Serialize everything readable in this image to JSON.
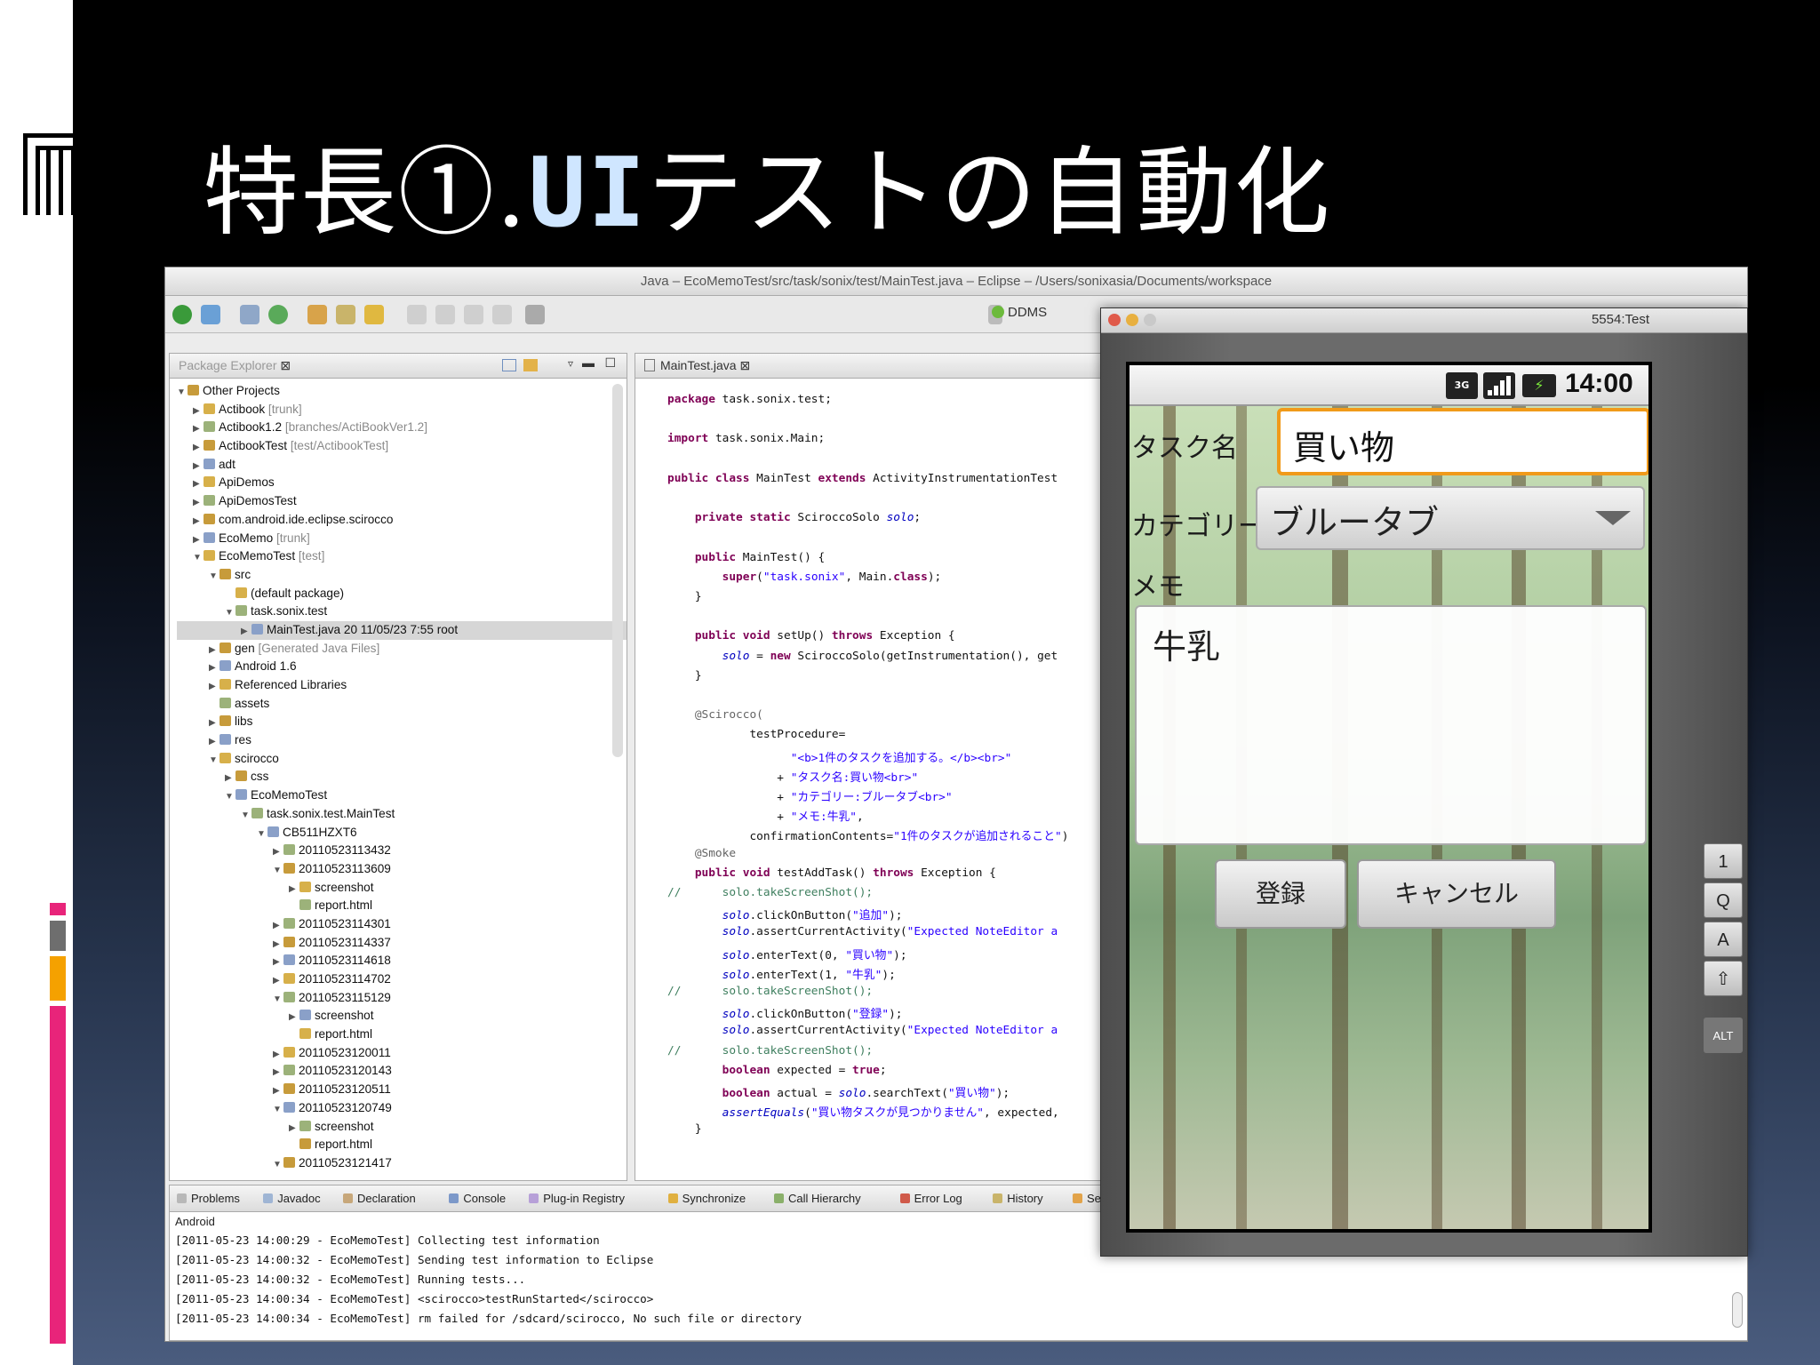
{
  "slide": {
    "title_prefix": "特長①.",
    "title_ui": "UI",
    "title_suffix": "テストの自動化"
  },
  "colors": {
    "accent_pink": "#e8247a",
    "accent_gray": "#6e6e6e",
    "accent_orange": "#f5a100",
    "input_focus_orange": "#f09a1a"
  },
  "eclipse": {
    "window_title": "Java – EcoMemoTest/src/task/sonix/test/MainTest.java – Eclipse – /Users/sonixasia/Documents/workspace",
    "perspective_label": "DDMS",
    "package_explorer_tab": "Package Explorer",
    "editor_tab": "MainTest.java",
    "tree": [
      {
        "label": "Other Projects",
        "suffix": "",
        "depth": 0,
        "twisty": "open"
      },
      {
        "label": "Actibook",
        "suffix": "[trunk]",
        "depth": 1,
        "twisty": "closed"
      },
      {
        "label": "Actibook1.2",
        "suffix": "[branches/ActiBookVer1.2]",
        "depth": 1,
        "twisty": "closed"
      },
      {
        "label": "ActibookTest",
        "suffix": "[test/ActibookTest]",
        "depth": 1,
        "twisty": "closed"
      },
      {
        "label": "adt",
        "suffix": "",
        "depth": 1,
        "twisty": "closed"
      },
      {
        "label": "ApiDemos",
        "suffix": "",
        "depth": 1,
        "twisty": "closed"
      },
      {
        "label": "ApiDemosTest",
        "suffix": "",
        "depth": 1,
        "twisty": "closed"
      },
      {
        "label": "com.android.ide.eclipse.scirocco",
        "suffix": "",
        "depth": 1,
        "twisty": "closed"
      },
      {
        "label": "EcoMemo",
        "suffix": "[trunk]",
        "depth": 1,
        "twisty": "closed"
      },
      {
        "label": "EcoMemoTest",
        "suffix": "[test]",
        "depth": 1,
        "twisty": "open"
      },
      {
        "label": "src",
        "suffix": "",
        "depth": 2,
        "twisty": "open"
      },
      {
        "label": "(default package)",
        "suffix": "",
        "depth": 3,
        "twisty": ""
      },
      {
        "label": "task.sonix.test",
        "suffix": "",
        "depth": 3,
        "twisty": "open"
      },
      {
        "label": "MainTest.java 20  11/05/23 7:55  root",
        "suffix": "",
        "depth": 4,
        "twisty": "closed",
        "selected": true
      },
      {
        "label": "gen",
        "suffix": "[Generated Java Files]",
        "depth": 2,
        "twisty": "closed"
      },
      {
        "label": "Android 1.6",
        "suffix": "",
        "depth": 2,
        "twisty": "closed"
      },
      {
        "label": "Referenced Libraries",
        "suffix": "",
        "depth": 2,
        "twisty": "closed"
      },
      {
        "label": "assets",
        "suffix": "",
        "depth": 2,
        "twisty": ""
      },
      {
        "label": "libs",
        "suffix": "",
        "depth": 2,
        "twisty": "closed"
      },
      {
        "label": "res",
        "suffix": "",
        "depth": 2,
        "twisty": "closed"
      },
      {
        "label": "scirocco",
        "suffix": "",
        "depth": 2,
        "twisty": "open"
      },
      {
        "label": "css",
        "suffix": "",
        "depth": 3,
        "twisty": "closed"
      },
      {
        "label": "EcoMemoTest",
        "suffix": "",
        "depth": 3,
        "twisty": "open"
      },
      {
        "label": "task.sonix.test.MainTest",
        "suffix": "",
        "depth": 4,
        "twisty": "open"
      },
      {
        "label": "CB511HZXT6",
        "suffix": "",
        "depth": 5,
        "twisty": "open"
      },
      {
        "label": "20110523113432",
        "suffix": "",
        "depth": 6,
        "twisty": "closed"
      },
      {
        "label": "20110523113609",
        "suffix": "",
        "depth": 6,
        "twisty": "open"
      },
      {
        "label": "screenshot",
        "suffix": "",
        "depth": 7,
        "twisty": "closed"
      },
      {
        "label": "report.html",
        "suffix": "",
        "depth": 7,
        "twisty": ""
      },
      {
        "label": "20110523114301",
        "suffix": "",
        "depth": 6,
        "twisty": "closed"
      },
      {
        "label": "20110523114337",
        "suffix": "",
        "depth": 6,
        "twisty": "closed"
      },
      {
        "label": "20110523114618",
        "suffix": "",
        "depth": 6,
        "twisty": "closed"
      },
      {
        "label": "20110523114702",
        "suffix": "",
        "depth": 6,
        "twisty": "closed"
      },
      {
        "label": "20110523115129",
        "suffix": "",
        "depth": 6,
        "twisty": "open"
      },
      {
        "label": "screenshot",
        "suffix": "",
        "depth": 7,
        "twisty": "closed"
      },
      {
        "label": "report.html",
        "suffix": "",
        "depth": 7,
        "twisty": ""
      },
      {
        "label": "20110523120011",
        "suffix": "",
        "depth": 6,
        "twisty": "closed"
      },
      {
        "label": "20110523120143",
        "suffix": "",
        "depth": 6,
        "twisty": "closed"
      },
      {
        "label": "20110523120511",
        "suffix": "",
        "depth": 6,
        "twisty": "closed"
      },
      {
        "label": "20110523120749",
        "suffix": "",
        "depth": 6,
        "twisty": "open"
      },
      {
        "label": "screenshot",
        "suffix": "",
        "depth": 7,
        "twisty": "closed"
      },
      {
        "label": "report.html",
        "suffix": "",
        "depth": 7,
        "twisty": ""
      },
      {
        "label": "20110523121417",
        "suffix": "",
        "depth": 6,
        "twisty": "open"
      }
    ],
    "code_lines": [
      [
        [
          "kw",
          "package"
        ],
        [
          "n",
          " task.sonix.test;"
        ]
      ],
      [],
      [
        [
          "kw",
          "import"
        ],
        [
          "n",
          " task.sonix.Main;"
        ]
      ],
      [],
      [
        [
          "kw",
          "public class"
        ],
        [
          "n",
          " MainTest "
        ],
        [
          "kw",
          "extends"
        ],
        [
          "n",
          " ActivityInstrumentationTest"
        ]
      ],
      [],
      [
        [
          "n",
          "    "
        ],
        [
          "kw",
          "private static"
        ],
        [
          "n",
          " SciroccoSolo "
        ],
        [
          "fld",
          "solo"
        ],
        [
          "n",
          ";"
        ]
      ],
      [],
      [
        [
          "n",
          "    "
        ],
        [
          "kw",
          "public"
        ],
        [
          "n",
          " MainTest() {"
        ]
      ],
      [
        [
          "n",
          "        "
        ],
        [
          "kw",
          "super"
        ],
        [
          "n",
          "("
        ],
        [
          "str",
          "\"task.sonix\""
        ],
        [
          "n",
          ", Main."
        ],
        [
          "kw",
          "class"
        ],
        [
          "n",
          ");"
        ]
      ],
      [
        [
          "n",
          "    }"
        ]
      ],
      [],
      [
        [
          "n",
          "    "
        ],
        [
          "kw",
          "public void"
        ],
        [
          "n",
          " setUp() "
        ],
        [
          "kw",
          "throws"
        ],
        [
          "n",
          " Exception {"
        ]
      ],
      [
        [
          "n",
          "        "
        ],
        [
          "fld",
          "solo"
        ],
        [
          "n",
          " = "
        ],
        [
          "kw",
          "new"
        ],
        [
          "n",
          " SciroccoSolo(getInstrumentation(), get"
        ]
      ],
      [
        [
          "n",
          "    }"
        ]
      ],
      [],
      [
        [
          "ann",
          "    @Scirocco("
        ]
      ],
      [
        [
          "n",
          "            testProcedure="
        ]
      ],
      [
        [
          "n",
          "                  "
        ],
        [
          "str",
          "\"<b>1件のタスクを追加する。</b><br>\""
        ]
      ],
      [
        [
          "n",
          "                + "
        ],
        [
          "str",
          "\"タスク名:買い物<br>\""
        ]
      ],
      [
        [
          "n",
          "                + "
        ],
        [
          "str",
          "\"カテゴリー:ブルータブ<br>\""
        ]
      ],
      [
        [
          "n",
          "                + "
        ],
        [
          "str",
          "\"メモ:牛乳\""
        ],
        [
          "n",
          ","
        ]
      ],
      [
        [
          "n",
          "            confirmationContents="
        ],
        [
          "str",
          "\"1件のタスクが追加されること\""
        ],
        [
          "n",
          ")"
        ]
      ],
      [
        [
          "ann",
          "    @Smoke"
        ]
      ],
      [
        [
          "n",
          "    "
        ],
        [
          "kw",
          "public void"
        ],
        [
          "n",
          " testAddTask() "
        ],
        [
          "kw",
          "throws"
        ],
        [
          "n",
          " Exception {"
        ]
      ],
      [
        [
          "cm",
          "//      solo.takeScreenShot();"
        ]
      ],
      [
        [
          "n",
          "        "
        ],
        [
          "fld",
          "solo"
        ],
        [
          "n",
          ".clickOnButton("
        ],
        [
          "str",
          "\"追加\""
        ],
        [
          "n",
          ");"
        ]
      ],
      [
        [
          "n",
          "        "
        ],
        [
          "fld",
          "solo"
        ],
        [
          "n",
          ".assertCurrentActivity("
        ],
        [
          "str",
          "\"Expected NoteEditor a"
        ]
      ],
      [
        [
          "n",
          "        "
        ],
        [
          "fld",
          "solo"
        ],
        [
          "n",
          ".enterText(0, "
        ],
        [
          "str",
          "\"買い物\""
        ],
        [
          "n",
          ");"
        ]
      ],
      [
        [
          "n",
          "        "
        ],
        [
          "fld",
          "solo"
        ],
        [
          "n",
          ".enterText(1, "
        ],
        [
          "str",
          "\"牛乳\""
        ],
        [
          "n",
          ");"
        ]
      ],
      [
        [
          "cm",
          "//      solo.takeScreenShot();"
        ]
      ],
      [
        [
          "n",
          "        "
        ],
        [
          "fld",
          "solo"
        ],
        [
          "n",
          ".clickOnButton("
        ],
        [
          "str",
          "\"登録\""
        ],
        [
          "n",
          ");"
        ]
      ],
      [
        [
          "n",
          "        "
        ],
        [
          "fld",
          "solo"
        ],
        [
          "n",
          ".assertCurrentActivity("
        ],
        [
          "str",
          "\"Expected NoteEditor a"
        ]
      ],
      [
        [
          "cm",
          "//      solo.takeScreenShot();"
        ]
      ],
      [
        [
          "n",
          "        "
        ],
        [
          "kw",
          "boolean"
        ],
        [
          "n",
          " expected = "
        ],
        [
          "kw",
          "true"
        ],
        [
          "n",
          ";"
        ]
      ],
      [
        [
          "n",
          "        "
        ],
        [
          "kw",
          "boolean"
        ],
        [
          "n",
          " actual = "
        ],
        [
          "fld",
          "solo"
        ],
        [
          "n",
          ".searchText("
        ],
        [
          "str",
          "\"買い物\""
        ],
        [
          "n",
          ");"
        ]
      ],
      [
        [
          "n",
          "        "
        ],
        [
          "fld",
          "assertEquals"
        ],
        [
          "n",
          "("
        ],
        [
          "str",
          "\"買い物タスクが見つかりません\""
        ],
        [
          "n",
          ", expected,"
        ]
      ],
      [
        [
          "n",
          "    }"
        ]
      ]
    ],
    "bottom_tabs": [
      "Problems",
      "Javadoc",
      "Declaration",
      "Console",
      "Plug-in Registry",
      "Synchronize",
      "Call Hierarchy",
      "Error Log",
      "History",
      "Search"
    ],
    "console_label": "Android",
    "console_lines": [
      "[2011-05-23 14:00:29 - EcoMemoTest] Collecting test information",
      "[2011-05-23 14:00:32 - EcoMemoTest] Sending test information to Eclipse",
      "[2011-05-23 14:00:32 - EcoMemoTest] Running tests...",
      "[2011-05-23 14:00:34 - EcoMemoTest] <scirocco>testRunStarted</scirocco>",
      "[2011-05-23 14:00:34 - EcoMemoTest] rm failed for /sdcard/scirocco, No such file or directory"
    ]
  },
  "emulator": {
    "window_title": "5554:Test",
    "status": {
      "network": "3G",
      "time": "14:00"
    },
    "app": {
      "task_name_label": "タスク名",
      "task_name_value": "買い物",
      "category_label": "カテゴリー",
      "category_value": "ブルータブ",
      "memo_label": "メモ",
      "memo_value": "牛乳",
      "register_button": "登録",
      "cancel_button": "キャンセル"
    },
    "keys": [
      "1",
      "Q",
      "A",
      "⇧",
      "ALT"
    ]
  }
}
